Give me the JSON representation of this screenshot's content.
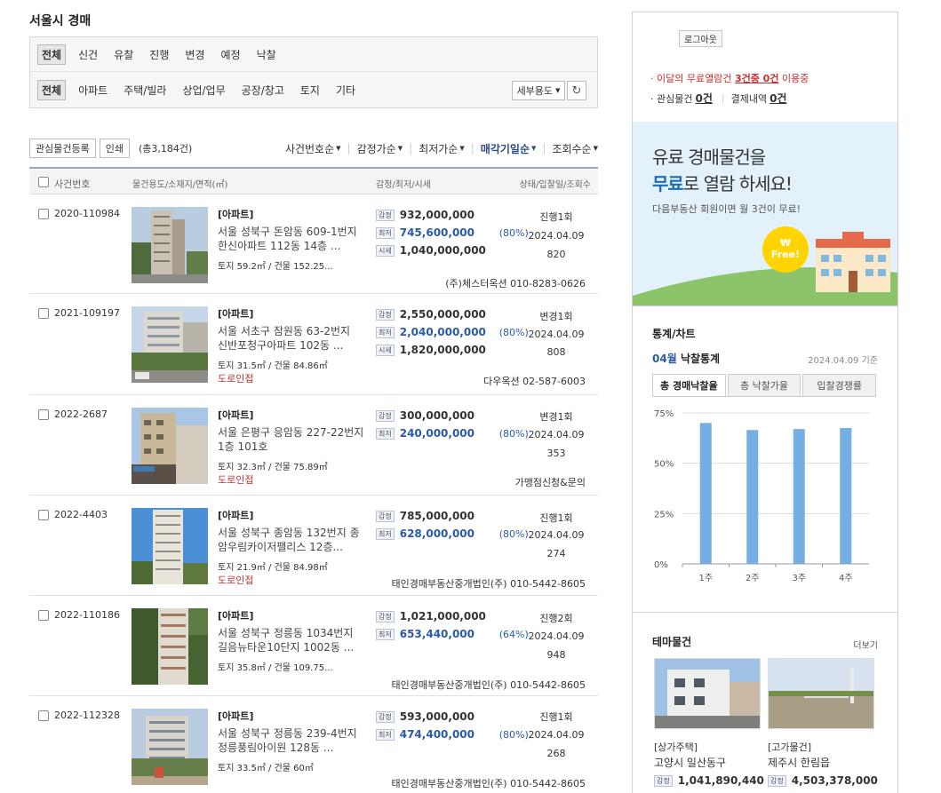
{
  "page_title": "서울시 경매",
  "filter": {
    "status_tabs": [
      "전체",
      "신건",
      "유찰",
      "진행",
      "변경",
      "예정",
      "낙찰"
    ],
    "type_tabs": [
      "전체",
      "아파트",
      "주택/빌라",
      "상업/업무",
      "공장/창고",
      "토지",
      "기타"
    ],
    "detail_select": "세부용도",
    "refresh_icon": "refresh-icon"
  },
  "toolbar": {
    "interest_button": "관심물건등록",
    "print_button": "인쇄",
    "total": "(총3,184건)",
    "sorts": [
      "사건번호순",
      "감정가순",
      "최저가순",
      "매각기일순",
      "조회수순"
    ]
  },
  "list_header": {
    "case_no": "사건번호",
    "property": "물건용도/소재지/면적(㎡)",
    "prices": "감정/최저/시세",
    "status": "상태/입찰일/조회수"
  },
  "price_tags": {
    "appraisal": "감정",
    "minimum": "최저",
    "market": "시세"
  },
  "rows": [
    {
      "case": "2020-110984",
      "type": "[아파트]",
      "addr1": "서울 성북구 돈암동 609-1번지",
      "addr2": "한신아파트 112동 14층 ...",
      "area": "토지 59.2㎡ / 건물 152.25...",
      "road": "",
      "appraisal": "932,000,000",
      "minimum": "745,600,000",
      "pct": "(80%)",
      "market": "1,040,000,000",
      "status": "진행1회",
      "date": "2024.04.09",
      "views": "820",
      "agent": "(주)체스터옥션 010-8283-0626"
    },
    {
      "case": "2021-109197",
      "type": "[아파트]",
      "addr1": "서울 서초구 잠원동 63-2번지",
      "addr2": "신반포청구아파트 102동 ...",
      "area": "토지 31.5㎡ / 건물 84.86㎡",
      "road": "도로인접",
      "appraisal": "2,550,000,000",
      "minimum": "2,040,000,000",
      "pct": "(80%)",
      "market": "1,820,000,000",
      "status": "변경1회",
      "date": "2024.04.09",
      "views": "808",
      "agent": "다우옥션 02-587-6003"
    },
    {
      "case": "2022-2687",
      "type": "[아파트]",
      "addr1": "서울 은평구 응암동 227-22번지",
      "addr2": "1층 101호",
      "area": "토지 32.3㎡ / 건물 75.89㎡",
      "road": "도로인접",
      "appraisal": "300,000,000",
      "minimum": "240,000,000",
      "pct": "(80%)",
      "market": "",
      "status": "변경1회",
      "date": "2024.04.09",
      "views": "353",
      "agent": "가맹점신청&문의"
    },
    {
      "case": "2022-4403",
      "type": "[아파트]",
      "addr1": "서울 성북구 종암동 132번지 종",
      "addr2": "암우림카이저팰리스 12층...",
      "area": "토지 21.9㎡ / 건물 84.98㎡",
      "road": "도로인접",
      "appraisal": "785,000,000",
      "minimum": "628,000,000",
      "pct": "(80%)",
      "market": "",
      "status": "진행1회",
      "date": "2024.04.09",
      "views": "274",
      "agent": "태인경매부동산중개법인(주) 010-5442-8605"
    },
    {
      "case": "2022-110186",
      "type": "[아파트]",
      "addr1": "서울 성북구 정릉동 1034번지",
      "addr2": "길음뉴타운10단지 1002동 ...",
      "area": "토지 35.8㎡ / 건물 109.75...",
      "road": "",
      "appraisal": "1,021,000,000",
      "minimum": "653,440,000",
      "pct": "(64%)",
      "market": "",
      "status": "진행2회",
      "date": "2024.04.09",
      "views": "948",
      "agent": "태인경매부동산중개법인(주) 010-5442-8605"
    },
    {
      "case": "2022-112328",
      "type": "[아파트]",
      "addr1": "서울 성북구 정릉동 239-4번지",
      "addr2": "정릉풍림아이원 128동 ...",
      "area": "토지 33.5㎡ / 건물 60㎡",
      "road": "",
      "appraisal": "593,000,000",
      "minimum": "474,400,000",
      "pct": "(80%)",
      "market": "",
      "status": "진행1회",
      "date": "2024.04.09",
      "views": "268",
      "agent": "태인경매부동산중개법인(주) 010-5442-8605"
    }
  ],
  "sidebar": {
    "logout": "로그아웃",
    "free_prefix": "· 이달의 무료열람건",
    "free_count": "3건중 0건",
    "free_suffix": "이용중",
    "interest_label": "· 관심물건",
    "interest_count": "0건",
    "payment_label": "결제내역",
    "payment_count": "0건",
    "banner_line1": "유료 경매물건을",
    "banner_bold": "무료",
    "banner_line2_rest": "로 열람 하세요!",
    "banner_sub": "다음부동산 회원이면 월 3건이 무료!",
    "banner_badge": "₩ Free!",
    "stats_title": "통계/차트",
    "stats_month": "04월",
    "stats_month_label": "낙찰통계",
    "stats_date": "2024.04.09 기준",
    "stats_tabs": [
      "총 경매낙찰율",
      "총 낙찰가율",
      "입찰경쟁률"
    ],
    "theme_title": "테마물건",
    "theme_more": "더보기",
    "theme_items": [
      {
        "cat": "[상가주택]",
        "loc": "고양시 일산동구",
        "tag": "감정",
        "price": "1,041,890,440"
      },
      {
        "cat": "[고가물건]",
        "loc": "제주시 한림읍",
        "tag": "감정",
        "price": "4,503,378,000"
      }
    ]
  },
  "chart_data": {
    "type": "bar",
    "title": "",
    "categories": [
      "1주",
      "2주",
      "3주",
      "4주"
    ],
    "values": [
      70,
      66.5,
      67,
      67.5
    ],
    "ylim": [
      0,
      75
    ],
    "yticks": [
      "0%",
      "25%",
      "50%",
      "75%"
    ],
    "grid": true,
    "color": "#74aee3"
  }
}
